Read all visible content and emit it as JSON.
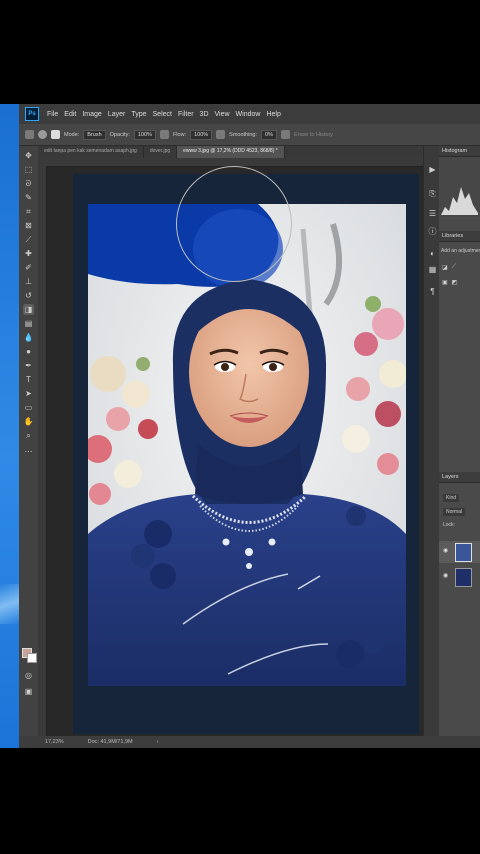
{
  "menubar": {
    "logo": "Ps",
    "items": [
      "File",
      "Edit",
      "Image",
      "Layer",
      "Type",
      "Select",
      "Filter",
      "3D",
      "View",
      "Window",
      "Help"
    ]
  },
  "options": {
    "mode_label": "Mode:",
    "mode_value": "Brush",
    "opacity_label": "Opacity:",
    "opacity_value": "100%",
    "flow_label": "Flow:",
    "flow_value": "100%",
    "smoothing_label": "Smoothing:",
    "smoothing_value": "0%",
    "erase_history": "Erase to History"
  },
  "tabs": [
    {
      "label": "edit tanpa pen kak semenadam asaph.jpg"
    },
    {
      "label": "dover.jpg"
    },
    {
      "label": "ewww 3.jpg @ 17,2% (DDD 4523, 868/8) *",
      "active": true
    }
  ],
  "panels": {
    "histogram": "Histogram",
    "libraries": "Libraries",
    "adjustments_hint": "Add an adjustment",
    "layers": "Layers",
    "kind": "Kind",
    "blend": "Normal",
    "lock": "Lock:"
  },
  "status": {
    "zoom": "17,23%",
    "doc": "Doc: 41,9M/71,9M"
  },
  "colors": {
    "ps_bg": "#535353",
    "accent": "#31a8ff",
    "brush_blue": "#0a3aa8",
    "hijab": "#1b2f63",
    "dress": "#23387a"
  }
}
